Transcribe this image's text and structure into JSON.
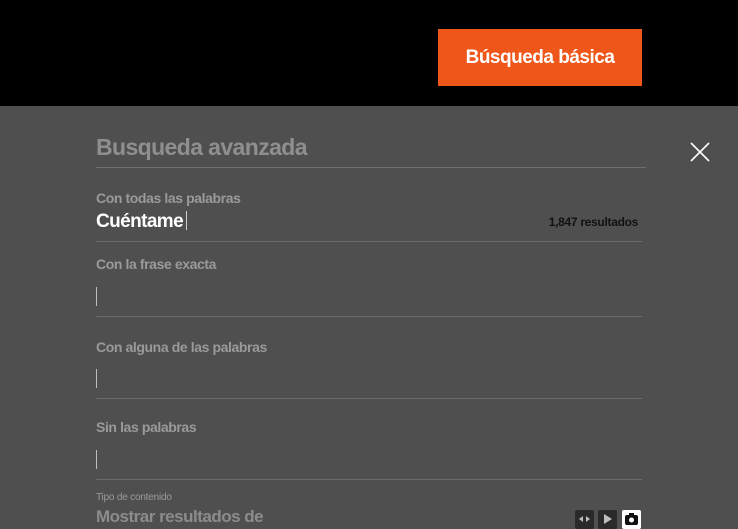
{
  "header": {
    "basic_search_label": "Búsqueda básica"
  },
  "panel": {
    "title": "Busqueda avanzada",
    "fields": {
      "all_words": {
        "label": "Con todas las palabras",
        "value": "Cuéntame",
        "results_count": "1,847 resultados"
      },
      "exact_phrase": {
        "label": "Con la frase exacta",
        "value": ""
      },
      "any_words": {
        "label": "Con alguna de las palabras",
        "value": ""
      },
      "without_words": {
        "label": "Sin las palabras",
        "value": ""
      }
    },
    "content_type": {
      "label": "Tipo de contenido",
      "heading": "Mostrar resultados de"
    },
    "content_type_icons": [
      "audio-icon",
      "video-icon",
      "camera-icon"
    ]
  },
  "colors": {
    "accent": "#ef5619",
    "topbar": "#000000",
    "panel": "#4f4f4f"
  }
}
